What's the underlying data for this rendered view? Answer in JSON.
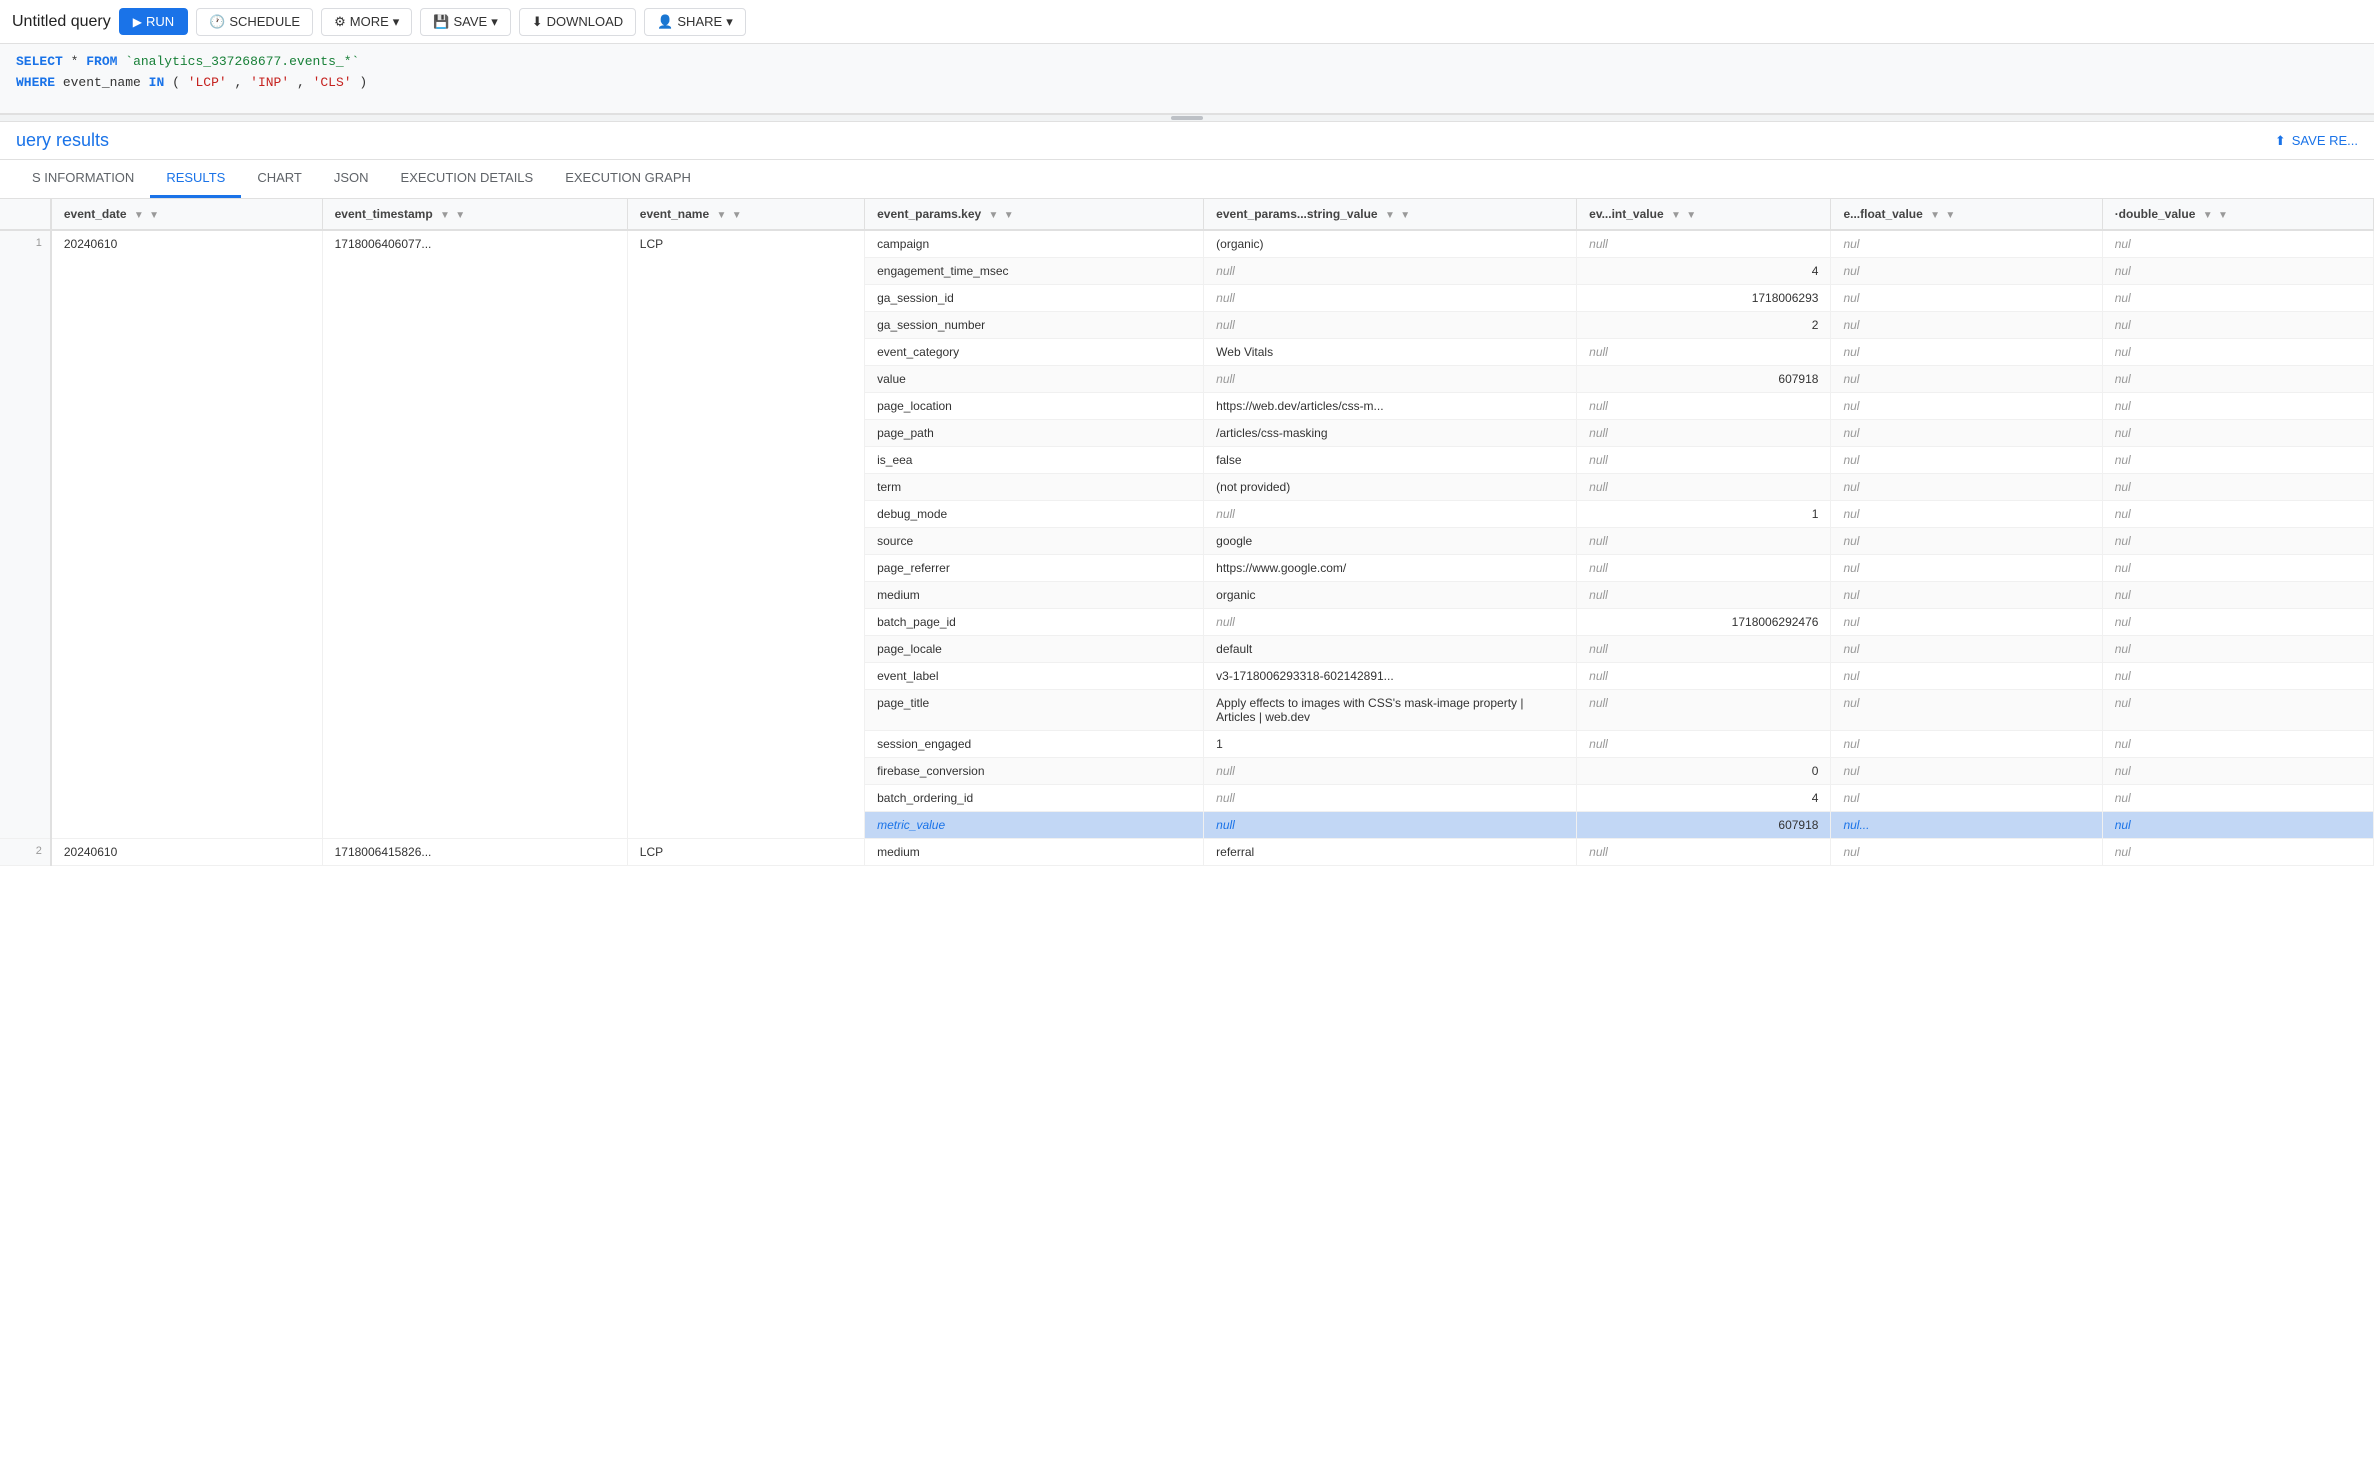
{
  "topbar": {
    "title": "Untitled query",
    "run_label": "RUN",
    "schedule_label": "SCHEDULE",
    "more_label": "MORE",
    "save_label": "SAVE",
    "download_label": "DOWNLOAD",
    "share_label": "SHARE"
  },
  "sql": {
    "line1_keyword1": "SELECT",
    "line1_rest": " * FROM ",
    "line1_table": "`analytics_337268677.events_*`",
    "line2_keyword1": "WHERE",
    "line2_field": " event_name ",
    "line2_keyword2": "IN",
    "line2_values": " ('LCP', 'INP', 'CLS')"
  },
  "results_section": {
    "title": "uery results",
    "save_label": "SAVE RE..."
  },
  "tabs": [
    {
      "id": "schema",
      "label": "S INFORMATION"
    },
    {
      "id": "results",
      "label": "RESULTS",
      "active": true
    },
    {
      "id": "chart",
      "label": "CHART"
    },
    {
      "id": "json",
      "label": "JSON"
    },
    {
      "id": "execution_details",
      "label": "EXECUTION DETAILS"
    },
    {
      "id": "execution_graph",
      "label": "EXECUTION GRAPH"
    }
  ],
  "table": {
    "columns": [
      {
        "id": "row_num",
        "label": ""
      },
      {
        "id": "event_date",
        "label": "event_date",
        "sortable": true,
        "filterable": true
      },
      {
        "id": "event_timestamp",
        "label": "event_timestamp",
        "sortable": true,
        "filterable": true
      },
      {
        "id": "event_name",
        "label": "event_name",
        "sortable": true,
        "filterable": true
      },
      {
        "id": "event_params_key",
        "label": "event_params.key",
        "sortable": true,
        "filterable": true
      },
      {
        "id": "event_params_string_value",
        "label": "event_params...string_value",
        "sortable": true,
        "filterable": true
      },
      {
        "id": "event_params_int_value",
        "label": "ev...int_value",
        "sortable": true,
        "filterable": true
      },
      {
        "id": "event_params_float_value",
        "label": "e...float_value",
        "sortable": true,
        "filterable": true
      },
      {
        "id": "event_params_double_value",
        "label": "·double_value",
        "sortable": true,
        "filterable": true
      }
    ],
    "rows": [
      {
        "row_num": "1",
        "event_date": "20240610",
        "event_timestamp": "1718006406077...",
        "event_name": "LCP",
        "subrows": [
          {
            "key": "campaign",
            "str_val": "(organic)",
            "int_val": null,
            "float_val": null,
            "double_val": null
          },
          {
            "key": "engagement_time_msec",
            "str_val": null,
            "int_val": "4",
            "float_val": null,
            "double_val": null
          },
          {
            "key": "ga_session_id",
            "str_val": null,
            "int_val": "1718006293",
            "float_val": null,
            "double_val": null
          },
          {
            "key": "ga_session_number",
            "str_val": null,
            "int_val": "2",
            "float_val": null,
            "double_val": null
          },
          {
            "key": "event_category",
            "str_val": "Web Vitals",
            "int_val": null,
            "float_val": null,
            "double_val": null
          },
          {
            "key": "value",
            "str_val": null,
            "int_val": "607918",
            "float_val": null,
            "double_val": null
          },
          {
            "key": "page_location",
            "str_val": "https://web.dev/articles/css-m...",
            "int_val": null,
            "float_val": null,
            "double_val": null
          },
          {
            "key": "page_path",
            "str_val": "/articles/css-masking",
            "int_val": null,
            "float_val": null,
            "double_val": null
          },
          {
            "key": "is_eea",
            "str_val": "false",
            "int_val": null,
            "float_val": null,
            "double_val": null
          },
          {
            "key": "term",
            "str_val": "(not provided)",
            "int_val": null,
            "float_val": null,
            "double_val": null
          },
          {
            "key": "debug_mode",
            "str_val": null,
            "int_val": "1",
            "float_val": null,
            "double_val": null
          },
          {
            "key": "source",
            "str_val": "google",
            "int_val": null,
            "float_val": null,
            "double_val": null
          },
          {
            "key": "page_referrer",
            "str_val": "https://www.google.com/",
            "int_val": null,
            "float_val": null,
            "double_val": null
          },
          {
            "key": "medium",
            "str_val": "organic",
            "int_val": null,
            "float_val": null,
            "double_val": null
          },
          {
            "key": "batch_page_id",
            "str_val": null,
            "int_val": "1718006292476",
            "float_val": null,
            "double_val": null
          },
          {
            "key": "page_locale",
            "str_val": "default",
            "int_val": null,
            "float_val": null,
            "double_val": null
          },
          {
            "key": "event_label",
            "str_val": "v3-1718006293318-602142891...",
            "int_val": null,
            "float_val": null,
            "double_val": null
          },
          {
            "key": "page_title",
            "str_val": "Apply effects to images with CSS's mask-image property  |  Articles  |  web.dev",
            "int_val": null,
            "float_val": null,
            "double_val": null
          },
          {
            "key": "session_engaged",
            "str_val": "1",
            "int_val": null,
            "float_val": null,
            "double_val": null
          },
          {
            "key": "firebase_conversion",
            "str_val": null,
            "int_val": "0",
            "float_val": null,
            "double_val": null
          },
          {
            "key": "batch_ordering_id",
            "str_val": null,
            "int_val": "4",
            "float_val": null,
            "double_val": null
          },
          {
            "key": "metric_value",
            "str_val": null,
            "int_val": "607918",
            "float_val": null,
            "double_val": null,
            "highlighted": true
          }
        ]
      },
      {
        "row_num": "2",
        "event_date": "20240610",
        "event_timestamp": "1718006415826...",
        "event_name": "LCP",
        "subrows": [
          {
            "key": "medium",
            "str_val": "referral",
            "int_val": null,
            "float_val": null,
            "double_val": null
          }
        ]
      }
    ]
  }
}
